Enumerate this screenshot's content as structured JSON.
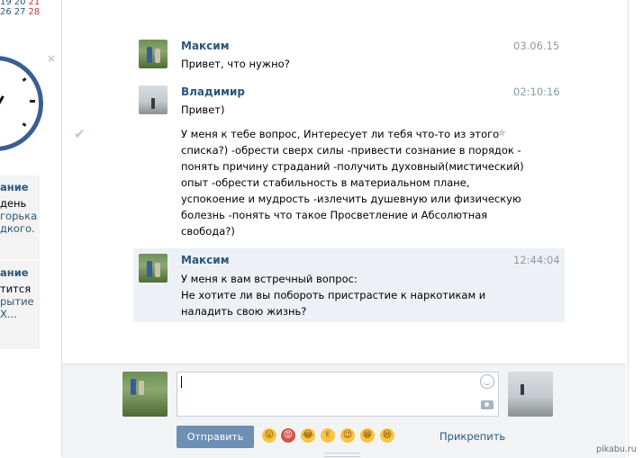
{
  "left_fragment": {
    "calendar_numbers_blue": [
      "26",
      "27"
    ],
    "calendar_number_red": "28",
    "calendar_top": [
      "19",
      "20",
      "21"
    ],
    "promo_a": {
      "title": "ание",
      "line1": "день",
      "line2": "горька",
      "line3": "дкого."
    },
    "promo_b": {
      "title": "ание",
      "line1": "тится",
      "line2": "рытие",
      "line3": "Х..."
    }
  },
  "messages": [
    {
      "author": "Максим",
      "time": "03.06.15",
      "lines": [
        "Привет, что нужно?"
      ]
    },
    {
      "author": "Владимир",
      "time": "02:10:16",
      "lines": [
        "Привет)"
      ]
    },
    {
      "lines": [
        "У меня к тебе вопрос, Интересует ли тебя что-то из этого",
        "списка?) -обрести сверх силы -привести сознание в порядок -",
        "понять причину страданий -получить духовный(мистический)",
        "опыт -обрести стабильность в материальном плане,",
        "успокоение и мудрость -излечить душевную или физическую",
        "болезнь -понять что такое Просветление и Абсолютная",
        "свобода?)"
      ]
    },
    {
      "author": "Максим",
      "time": "12:44:04",
      "lines": [
        "У меня к вам встречный вопрос:",
        "Не хотите ли вы побороть пристрастие к наркотикам и",
        "наладить свою жизнь?"
      ]
    }
  ],
  "composer": {
    "input_value": "",
    "send_label": "Отправить",
    "attach_label": "Прикрепить",
    "emojis": [
      "😛",
      "😡",
      "😂",
      "✌",
      "😉",
      "😁",
      "😆"
    ]
  },
  "watermark": "pikabu.ru"
}
